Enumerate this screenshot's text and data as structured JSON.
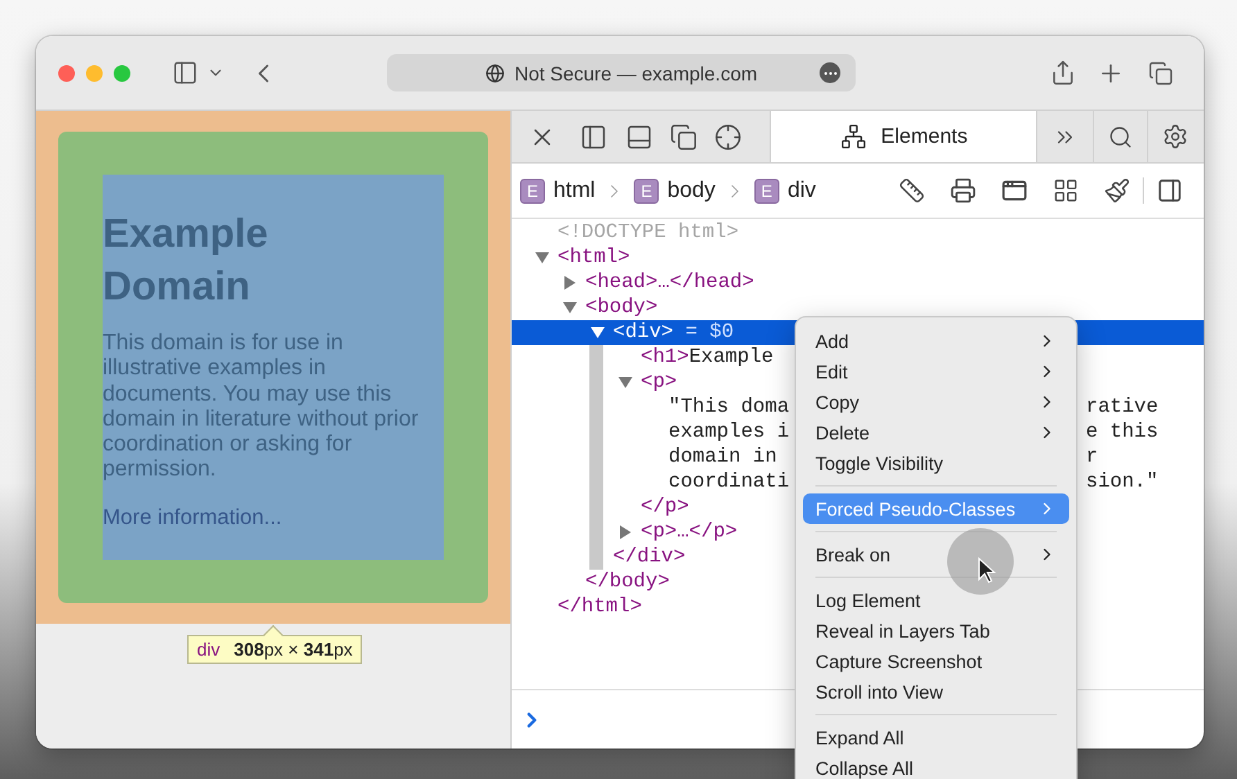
{
  "browser": {
    "address": "Not Secure — example.com"
  },
  "page": {
    "heading": "Example Domain",
    "paragraph": "This domain is for use in illustrative examples in documents. You may use this domain in literature without prior coordination or asking for permission.",
    "link": "More information...",
    "tooltip": {
      "tag": "div",
      "size": "**308**px × **341**px"
    }
  },
  "devtools": {
    "tabs": [
      {
        "label": "Elements",
        "selected": true
      }
    ],
    "breadcrumbs": [
      {
        "badge": "E",
        "label": "html"
      },
      {
        "badge": "E",
        "label": "body"
      },
      {
        "badge": "E",
        "label": "div"
      }
    ],
    "dom": [
      {
        "kind": "doctype",
        "text": "<!DOCTYPE html>"
      },
      {
        "kind": "element",
        "open": "<html>",
        "expanded": true,
        "selected": false,
        "close": "</html>",
        "children": [
          {
            "kind": "element",
            "open": "<head>…</head>",
            "expanded": false,
            "selected": false
          },
          {
            "kind": "element",
            "open": "<body>",
            "expanded": true,
            "selected": false,
            "close": "</body>",
            "children": [
              {
                "kind": "element",
                "open": "<div>",
                "suffix": "= $0",
                "expanded": true,
                "selected": true,
                "close": "</div>",
                "children": [
                  {
                    "kind": "inline",
                    "open": "<h1>",
                    "content": "Example",
                    "selected": false
                  },
                  {
                    "kind": "element",
                    "open": "<p>",
                    "expanded": true,
                    "selected": false,
                    "close": "</p>",
                    "children": [
                      {
                        "kind": "text",
                        "lines": [
                          {
                            "text": "\"This doma",
                            "tail": "rative"
                          },
                          {
                            "text": "examples i",
                            "tail": "e this"
                          },
                          {
                            "text": "domain in",
                            "tail": "r"
                          },
                          {
                            "text": "coordinati",
                            "tail": "sion.\""
                          }
                        ]
                      }
                    ]
                  },
                  {
                    "kind": "element",
                    "open": "<p>…</p>",
                    "expanded": false,
                    "selected": false
                  }
                ]
              }
            ]
          }
        ]
      }
    ]
  },
  "context_menu": [
    {
      "kind": "item",
      "label": "Add",
      "submenu": true,
      "selected": false
    },
    {
      "kind": "item",
      "label": "Edit",
      "submenu": true,
      "selected": false
    },
    {
      "kind": "item",
      "label": "Copy",
      "submenu": true,
      "selected": false
    },
    {
      "kind": "item",
      "label": "Delete",
      "submenu": true,
      "selected": false
    },
    {
      "kind": "item",
      "label": "Toggle Visibility",
      "submenu": false,
      "selected": false
    },
    {
      "kind": "separator"
    },
    {
      "kind": "item",
      "label": "Forced Pseudo-Classes",
      "submenu": true,
      "selected": true
    },
    {
      "kind": "separator"
    },
    {
      "kind": "item",
      "label": "Break on",
      "submenu": true,
      "selected": false
    },
    {
      "kind": "separator"
    },
    {
      "kind": "item",
      "label": "Log Element",
      "submenu": false,
      "selected": false
    },
    {
      "kind": "item",
      "label": "Reveal in Layers Tab",
      "submenu": false,
      "selected": false
    },
    {
      "kind": "item",
      "label": "Capture Screenshot",
      "submenu": false,
      "selected": false
    },
    {
      "kind": "item",
      "label": "Scroll into View",
      "submenu": false,
      "selected": false
    },
    {
      "kind": "separator"
    },
    {
      "kind": "item",
      "label": "Expand All",
      "submenu": false,
      "selected": false
    },
    {
      "kind": "item",
      "label": "Collapse All",
      "submenu": false,
      "selected": false
    }
  ]
}
